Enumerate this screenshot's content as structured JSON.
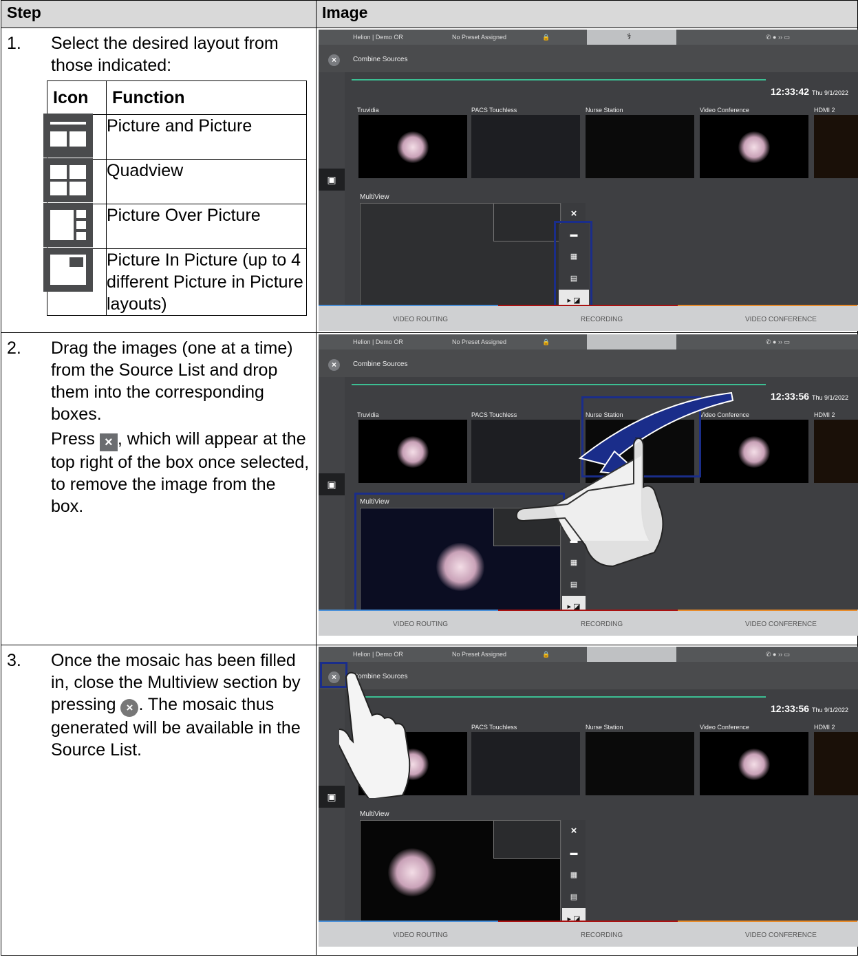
{
  "table": {
    "col_step": "Step",
    "col_image": "Image"
  },
  "steps": [
    {
      "num": "1.",
      "text": "Select the desired layout from those indicated:",
      "func_table": {
        "col_icon": "Icon",
        "col_function": "Function",
        "rows": [
          {
            "icon": "picture-and-picture-icon",
            "label": "Picture and Picture"
          },
          {
            "icon": "quadview-icon",
            "label": "Quadview"
          },
          {
            "icon": "picture-over-picture-icon",
            "label": "Picture Over Picture"
          },
          {
            "icon": "picture-in-picture-icon",
            "label": "Picture In Picture (up to 4 different Picture in Picture layouts)"
          }
        ]
      }
    },
    {
      "num": "2.",
      "text": "Drag the images (one at a time) from the Source List and drop them into the corresponding boxes.",
      "text2_pre": "Press",
      "text2_post": ", which will appear at the top right of the box once selected, to remove the image from the box."
    },
    {
      "num": "3.",
      "text_pre": "Once the mosaic has been filled in, close the Multiview section by pressing",
      "text_post": ". The mosaic thus generated will be available in the Source List."
    }
  ],
  "ui": {
    "room": "Helion | Demo OR",
    "preset": "No Preset Assigned",
    "header_title": "Combine Sources",
    "sources": [
      "Truvidia",
      "PACS Touchless",
      "Nurse Station",
      "Video Conference",
      "HDMI 2"
    ],
    "multiview_label": "MultiView",
    "date": "Thu 9/1/2022",
    "bottom_tabs": [
      "VIDEO ROUTING",
      "RECORDING",
      "VIDEO CONFERENCE"
    ],
    "shot_times": [
      "12:33:42",
      "12:33:56",
      "12:33:56"
    ]
  }
}
